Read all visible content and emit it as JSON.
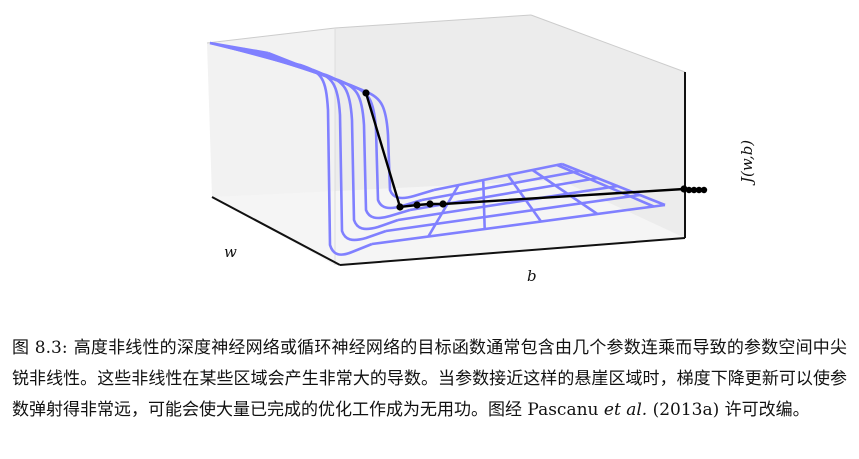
{
  "figure": {
    "chart_data": {
      "type": "surface",
      "axis_labels": {
        "w": "w",
        "b": "b",
        "z": "J(w,b)"
      },
      "grid_on": false,
      "surface_color": "#8080ff",
      "trajectory_color": "#000000",
      "trajectory_description_points": [
        {
          "step": 0
        },
        {
          "step": 1
        },
        {
          "step": 2
        },
        {
          "step": 3
        },
        {
          "step": 4
        },
        {
          "step": 5
        }
      ]
    }
  },
  "caption": {
    "label": "图 8.3:",
    "text_part1": "高度非线性的深度神经网络或循环神经网络的目标函数通常包含由几个参数连乘而导致的参数空间中尖锐非线性。这些非线性在某些区域会产生非常大的导数。当参数接近这样的悬崖区域时，梯度下降更新可以使参数弹射得非常远，可能会使大量已完成的优化工作成为无用功。图经 Pascanu ",
    "text_em": "et al.",
    "text_part2": " (2013a) 许可改编。"
  }
}
